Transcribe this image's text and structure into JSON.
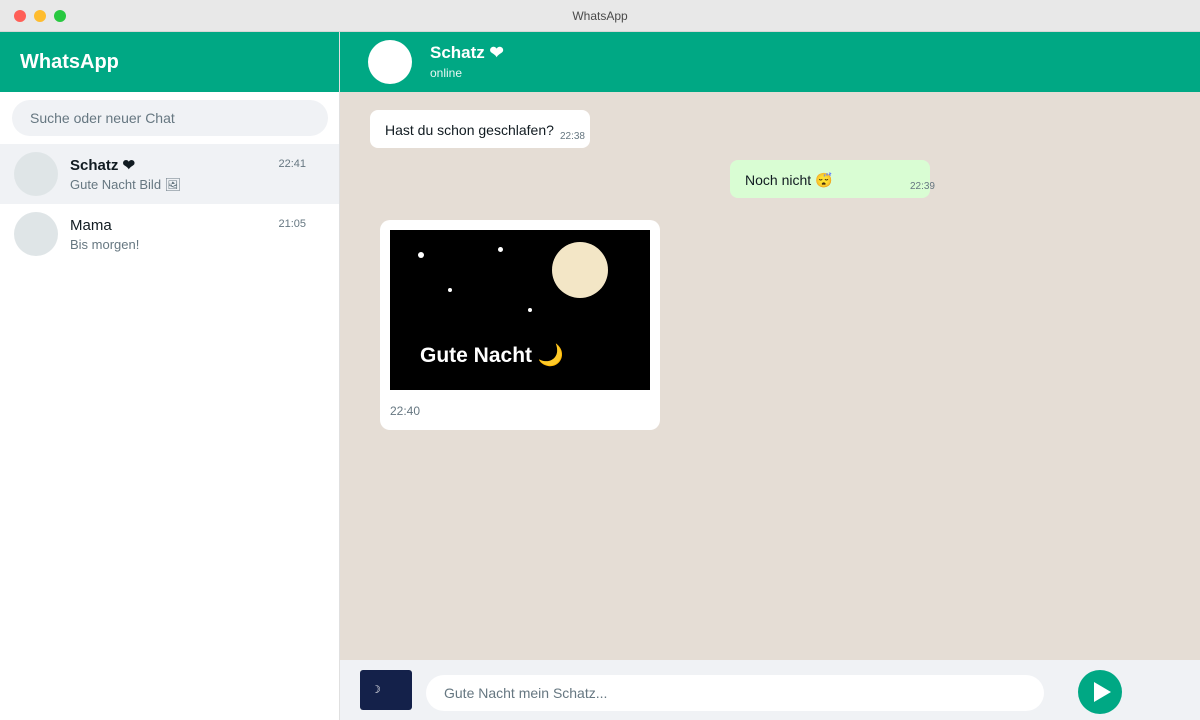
{
  "window": {
    "title": "WhatsApp"
  },
  "sidebar": {
    "app_name": "WhatsApp",
    "search_placeholder": "Suche oder neuer Chat",
    "chats": [
      {
        "name": "Schatz ❤",
        "preview": "Gute Nacht Bild 🖼",
        "time": "22:41",
        "active": true
      },
      {
        "name": "Mama",
        "preview": "Bis morgen!",
        "time": "21:05",
        "active": false
      }
    ]
  },
  "conversation": {
    "contact_name": "Schatz ❤",
    "status": "online",
    "messages": [
      {
        "direction": "incoming",
        "text": "Hast du schon geschlafen?",
        "time": "22:38"
      },
      {
        "direction": "outgoing",
        "text": "Noch nicht 😴",
        "time": "22:39"
      },
      {
        "direction": "incoming",
        "type": "image",
        "caption": "Gute Nacht 🌙",
        "time": "22:40"
      }
    ]
  },
  "composer": {
    "attachment_icon": "moon-icon",
    "attachment_glyph": "☽",
    "input_value": "",
    "input_placeholder": "Gute Nacht mein Schatz...",
    "send_icon": "send-icon"
  },
  "colors": {
    "accent": "#00a884",
    "chat_background": "#e5ddd5",
    "outgoing_bubble": "#d9fdd3",
    "incoming_bubble": "#ffffff",
    "moon": "#f3e6c6"
  }
}
